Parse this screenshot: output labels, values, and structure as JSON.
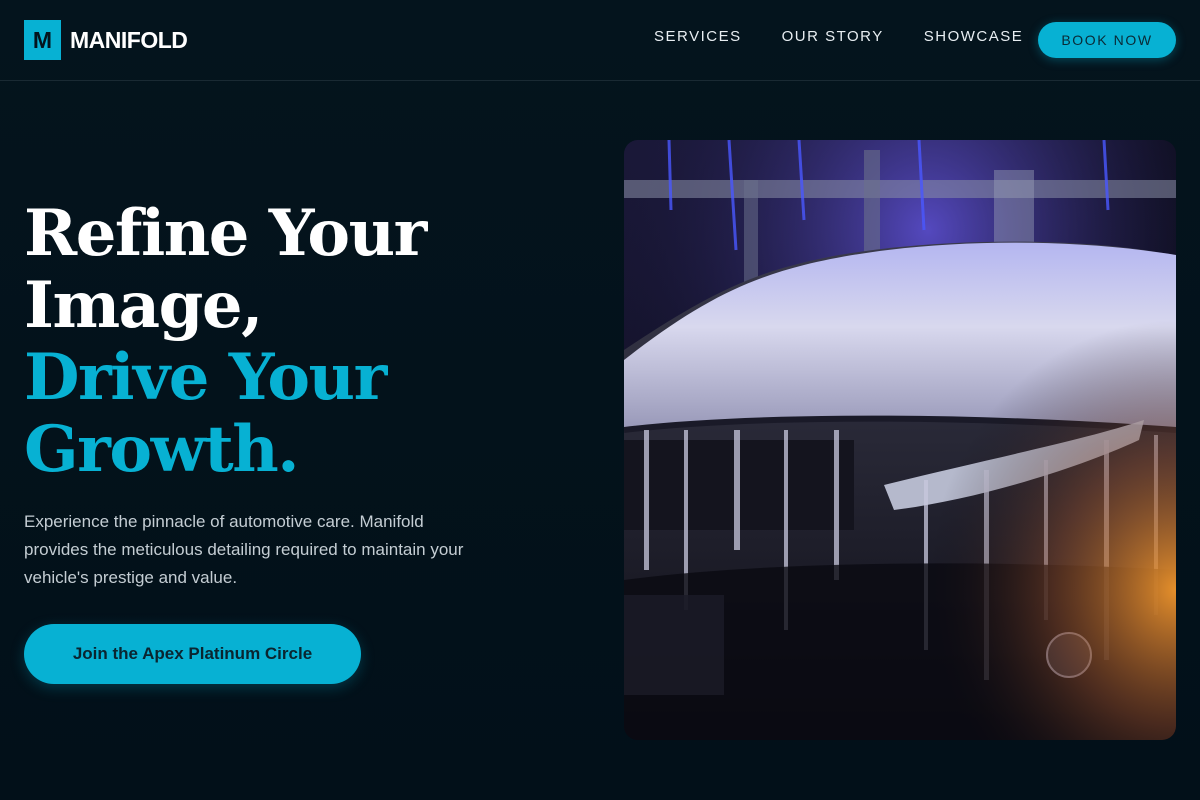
{
  "brand": {
    "logo_letter": "M",
    "name": "MANIFOLD"
  },
  "nav": {
    "items": [
      {
        "label": "SERVICES"
      },
      {
        "label": "OUR STORY"
      },
      {
        "label": "SHOWCASE"
      }
    ],
    "book_label": "BOOK NOW"
  },
  "hero": {
    "title_line1": "Refine Your",
    "title_line2": "Image,",
    "title_line3": "Drive Your",
    "title_line4": "Growth.",
    "description": "Experience the pinnacle of automotive care. Manifold provides the meticulous detailing required to maintain your vehicle's prestige and value.",
    "cta_label": "Join the Apex Platinum Circle",
    "image_subject": "foam-covered-car-photo"
  },
  "colors": {
    "background": "#03141d",
    "accent": "#07b1d3",
    "text_primary": "#ffffff",
    "text_muted": "#c4cdd3"
  }
}
